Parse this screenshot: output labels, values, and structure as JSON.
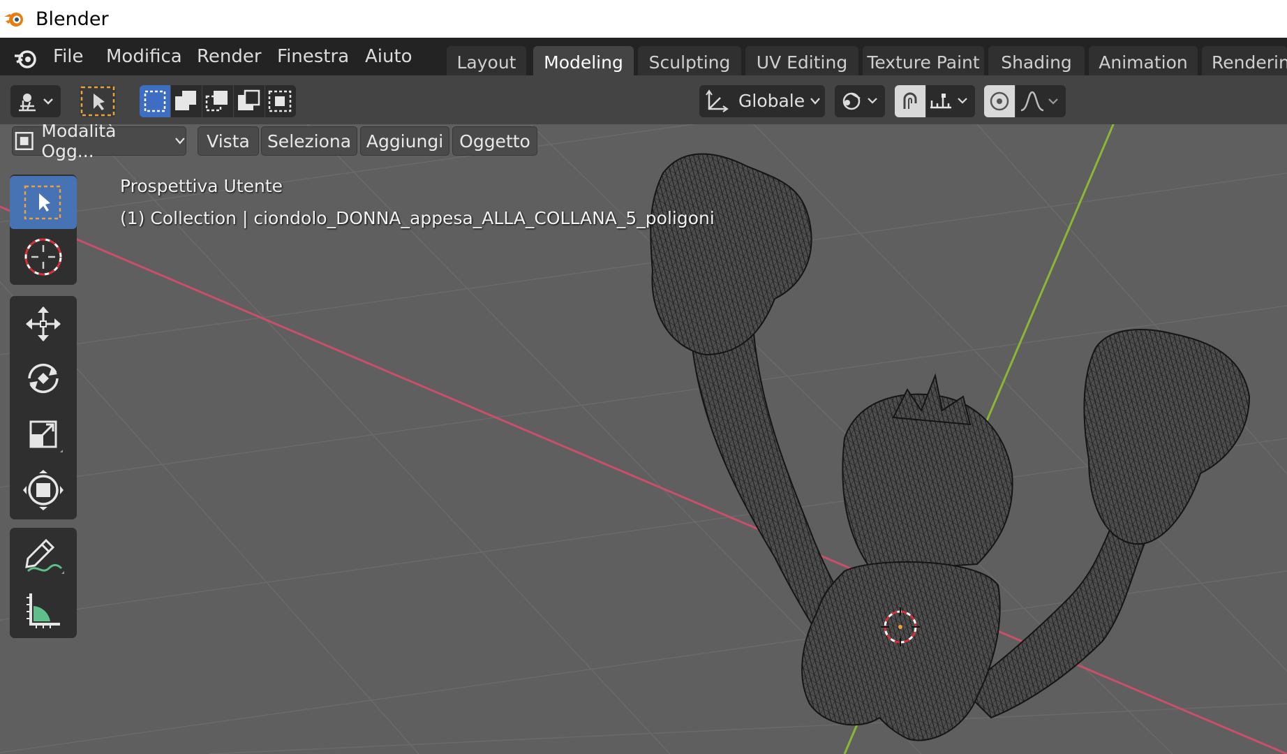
{
  "window": {
    "title": "Blender"
  },
  "menu": {
    "items": [
      "File",
      "Modifica",
      "Render",
      "Finestra",
      "Aiuto"
    ]
  },
  "workspaces": {
    "tabs": [
      "Layout",
      "Modeling",
      "Sculpting",
      "UV Editing",
      "Texture Paint",
      "Shading",
      "Animation",
      "Renderin"
    ],
    "active": "Modeling"
  },
  "header": {
    "transform_orientation": "Globale"
  },
  "viewport_menu": {
    "mode_label": "Modalità Ogg...",
    "items": [
      "Vista",
      "Seleziona",
      "Aggiungi",
      "Oggetto"
    ]
  },
  "toolbar": {
    "tools": [
      "select-box",
      "cursor",
      "move",
      "rotate",
      "scale",
      "transform",
      "annotate",
      "measure"
    ],
    "active": "select-box"
  },
  "overlay": {
    "view_name": "Prospettiva Utente",
    "object_info": "(1) Collection | ciondolo_DONNA_appesa_ALLA_COLLANA_5_poligoni"
  },
  "colors": {
    "x_axis": "#c8506a",
    "y_axis": "#8ab835",
    "active_tool": "#4772b3",
    "viewport_bg": "#5f5f5f",
    "mesh_wire": "#1c1c1c"
  }
}
